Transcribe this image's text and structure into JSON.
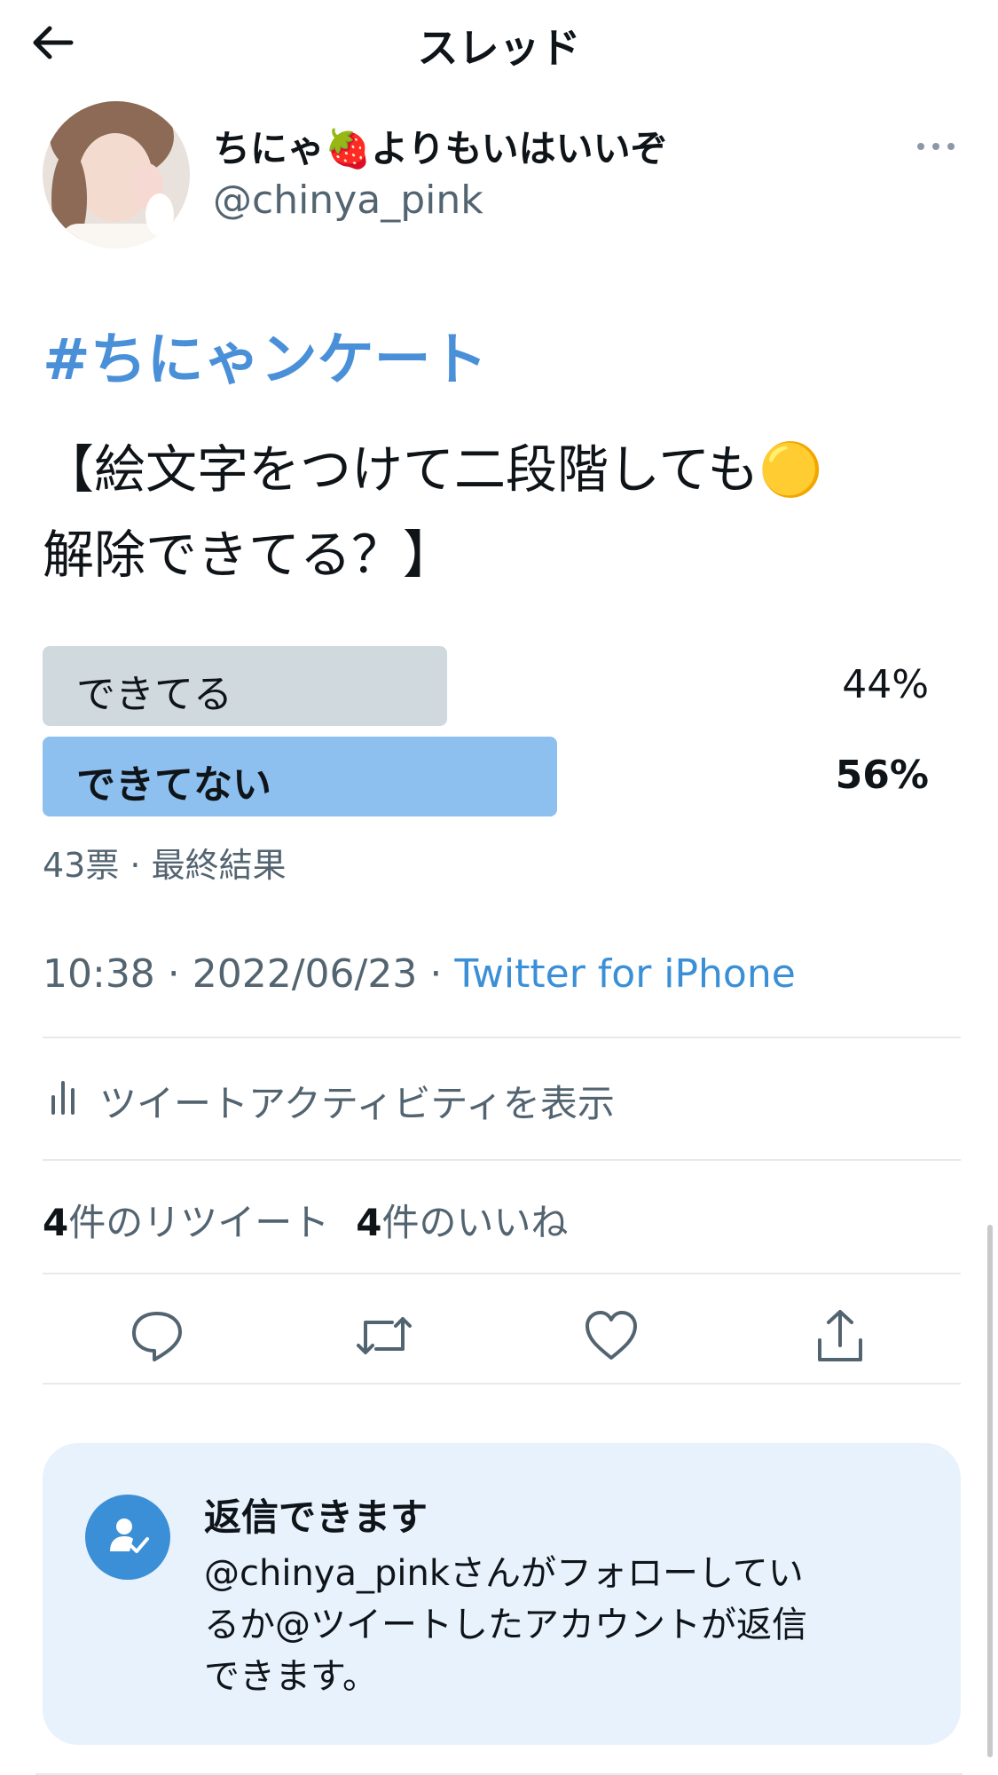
{
  "header": {
    "title": "スレッド"
  },
  "author": {
    "name": "ちにゃ🍓よりもいはいいぞ",
    "handle": "@chinya_pink"
  },
  "tweet": {
    "hashtag": "#ちにゃンケート",
    "lines": [
      "【絵文字をつけて二段階しても🟡",
      "解除できてる？】"
    ]
  },
  "poll": {
    "options": [
      {
        "label": "できてる",
        "percent": "44%",
        "share": 0.44
      },
      {
        "label": "できてない",
        "percent": "56%",
        "share": 0.56,
        "winner": true
      }
    ],
    "summary": "43票 · 最終結果"
  },
  "meta": {
    "time_date": "10:38 · 2022/06/23 · ",
    "source": "Twitter for iPhone"
  },
  "activity": {
    "label": "ツイートアクティビティを表示"
  },
  "stats": {
    "retweets": {
      "count": "4",
      "label": "件のリツイート"
    },
    "likes": {
      "count": "4",
      "label": "件のいいね"
    }
  },
  "actions": [
    "reply-icon",
    "retweet-icon",
    "like-icon",
    "share-icon"
  ],
  "reply_notice": {
    "title": "返信できます",
    "lines": [
      "@chinya_pinkさんがフォローしてい",
      "るか@ツイートしたアカウントが返信",
      "できます。"
    ]
  },
  "colors": {
    "accent": "#3b8fd6",
    "poll_winner": "#8ec0ef",
    "poll_other": "#cfd9de",
    "notice_bg": "#e8f2fc"
  }
}
